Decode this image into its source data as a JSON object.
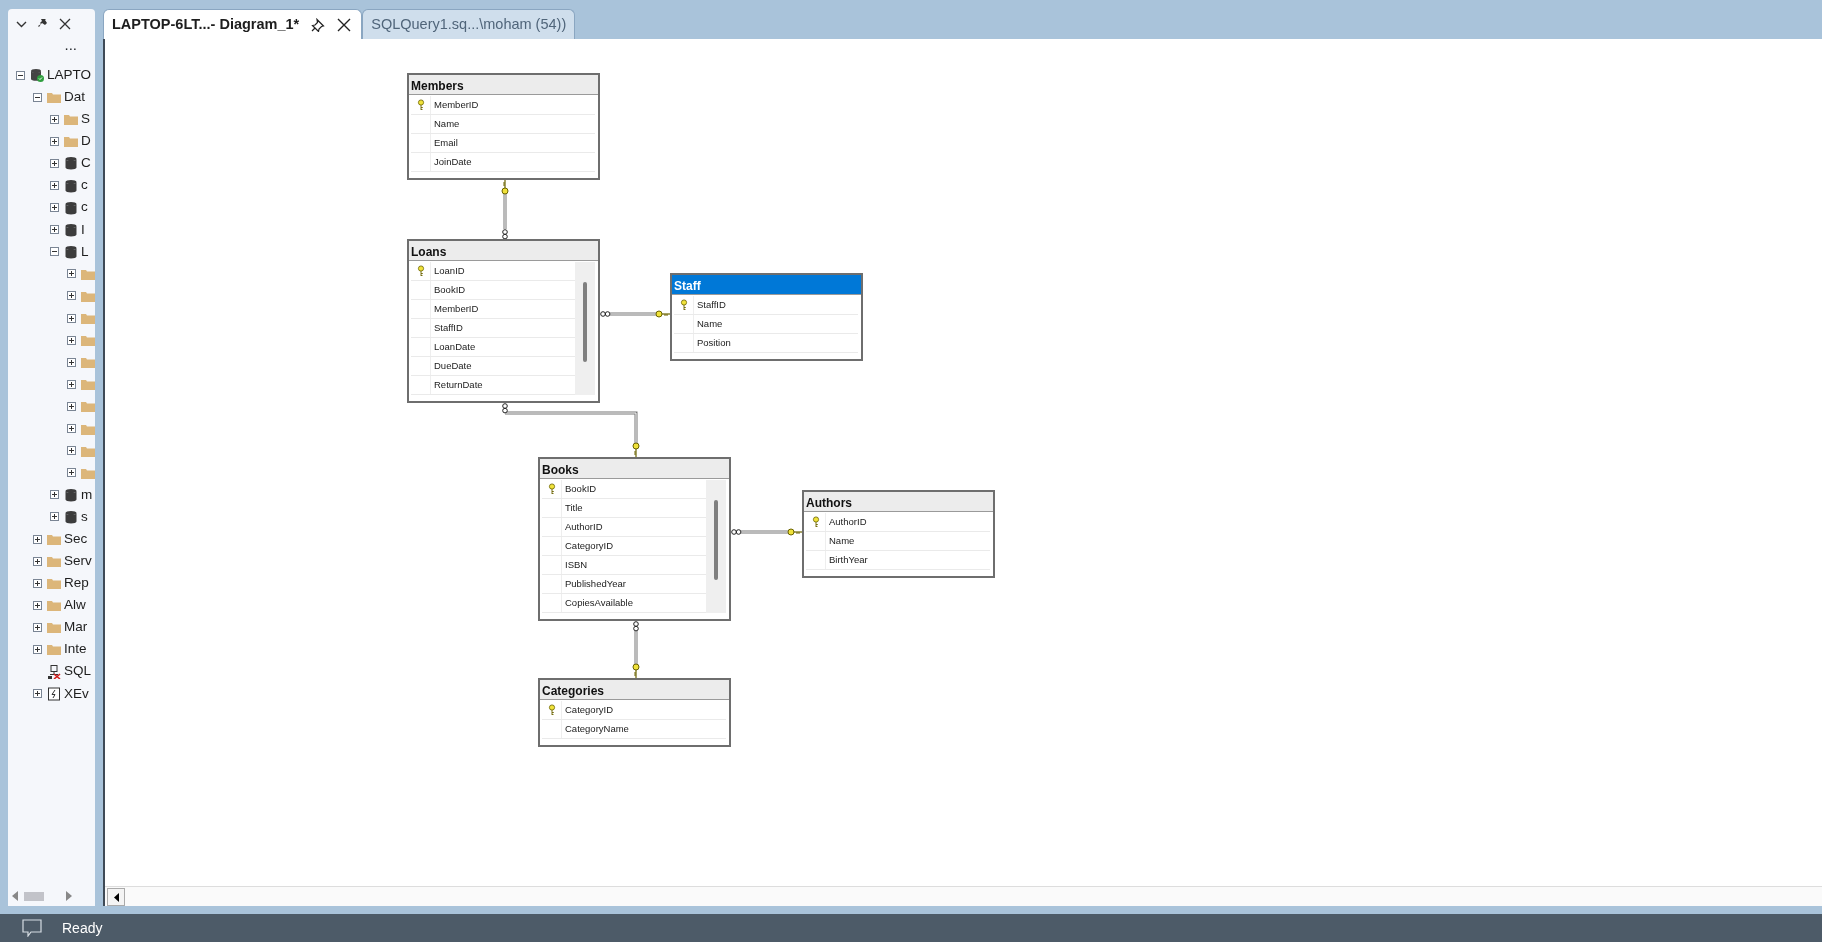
{
  "explorer": {
    "more_label": "...",
    "tree": [
      {
        "label": "LAPTO",
        "kind": "server",
        "expanded": true,
        "children": [
          {
            "label": "Dat",
            "kind": "folder",
            "expanded": true,
            "children": [
              {
                "label": "S",
                "kind": "folder",
                "expanded": false
              },
              {
                "label": "D",
                "kind": "folder",
                "expanded": false
              },
              {
                "label": "C",
                "kind": "database",
                "expanded": false
              },
              {
                "label": "c",
                "kind": "database",
                "expanded": false
              },
              {
                "label": "c",
                "kind": "database",
                "expanded": false
              },
              {
                "label": "I",
                "kind": "database",
                "expanded": false
              },
              {
                "label": "L",
                "kind": "database",
                "expanded": true,
                "children": [
                  {
                    "kind": "folder",
                    "expanded": false
                  },
                  {
                    "kind": "folder",
                    "expanded": false
                  },
                  {
                    "kind": "folder",
                    "expanded": false
                  },
                  {
                    "kind": "folder",
                    "expanded": false
                  },
                  {
                    "kind": "folder",
                    "expanded": false
                  },
                  {
                    "kind": "folder",
                    "expanded": false
                  },
                  {
                    "kind": "folder",
                    "expanded": false
                  },
                  {
                    "kind": "folder",
                    "expanded": false
                  },
                  {
                    "kind": "folder",
                    "expanded": false
                  },
                  {
                    "kind": "folder",
                    "expanded": false
                  }
                ]
              },
              {
                "label": "m",
                "kind": "database",
                "expanded": false
              },
              {
                "label": "s",
                "kind": "database",
                "expanded": false
              }
            ]
          },
          {
            "label": "Sec",
            "kind": "folder",
            "expanded": false
          },
          {
            "label": "Serv",
            "kind": "folder",
            "expanded": false
          },
          {
            "label": "Rep",
            "kind": "folder",
            "expanded": false
          },
          {
            "label": "Alw",
            "kind": "folder",
            "expanded": false
          },
          {
            "label": "Mar",
            "kind": "folder",
            "expanded": false
          },
          {
            "label": "Inte",
            "kind": "folder",
            "expanded": false
          },
          {
            "label": "SQL",
            "kind": "agent"
          },
          {
            "label": "XEv",
            "kind": "xevent",
            "expanded": false
          }
        ]
      }
    ]
  },
  "tabs": [
    {
      "label": "LAPTOP-6LT...- Diagram_1*",
      "selected": true
    },
    {
      "label": "SQLQuery1.sq...\\moham (54))",
      "selected": false
    }
  ],
  "diagram": {
    "tables": [
      {
        "name": "Members",
        "selected": false,
        "scrollbar": false,
        "columns": [
          {
            "name": "MemberID",
            "primary_key": true
          },
          {
            "name": "Name",
            "primary_key": false
          },
          {
            "name": "Email",
            "primary_key": false
          },
          {
            "name": "JoinDate",
            "primary_key": false
          }
        ]
      },
      {
        "name": "Loans",
        "selected": false,
        "scrollbar": true,
        "columns": [
          {
            "name": "LoanID",
            "primary_key": true
          },
          {
            "name": "BookID",
            "primary_key": false
          },
          {
            "name": "MemberID",
            "primary_key": false
          },
          {
            "name": "StaffID",
            "primary_key": false
          },
          {
            "name": "LoanDate",
            "primary_key": false
          },
          {
            "name": "DueDate",
            "primary_key": false
          },
          {
            "name": "ReturnDate",
            "primary_key": false
          }
        ]
      },
      {
        "name": "Staff",
        "selected": true,
        "scrollbar": false,
        "columns": [
          {
            "name": "StaffID",
            "primary_key": true
          },
          {
            "name": "Name",
            "primary_key": false
          },
          {
            "name": "Position",
            "primary_key": false
          }
        ]
      },
      {
        "name": "Books",
        "selected": false,
        "scrollbar": true,
        "columns": [
          {
            "name": "BookID",
            "primary_key": true
          },
          {
            "name": "Title",
            "primary_key": false
          },
          {
            "name": "AuthorID",
            "primary_key": false
          },
          {
            "name": "CategoryID",
            "primary_key": false
          },
          {
            "name": "ISBN",
            "primary_key": false
          },
          {
            "name": "PublishedYear",
            "primary_key": false
          },
          {
            "name": "CopiesAvailable",
            "primary_key": false
          }
        ]
      },
      {
        "name": "Authors",
        "selected": false,
        "scrollbar": false,
        "columns": [
          {
            "name": "AuthorID",
            "primary_key": true
          },
          {
            "name": "Name",
            "primary_key": false
          },
          {
            "name": "BirthYear",
            "primary_key": false
          }
        ]
      },
      {
        "name": "Categories",
        "selected": false,
        "scrollbar": false,
        "columns": [
          {
            "name": "CategoryID",
            "primary_key": true
          },
          {
            "name": "CategoryName",
            "primary_key": false
          }
        ]
      }
    ]
  },
  "status_bar": {
    "text": "Ready"
  }
}
